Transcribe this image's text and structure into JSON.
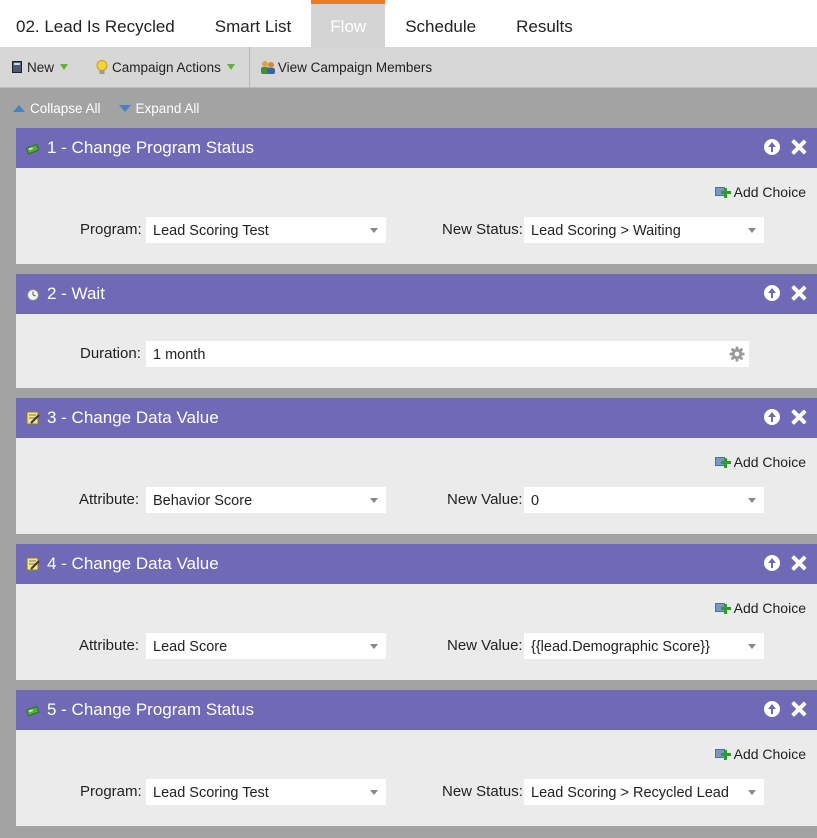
{
  "tabs": [
    {
      "label": "02. Lead Is Recycled",
      "active": false
    },
    {
      "label": "Smart List",
      "active": false
    },
    {
      "label": "Flow",
      "active": true
    },
    {
      "label": "Schedule",
      "active": false
    },
    {
      "label": "Results",
      "active": false
    }
  ],
  "toolbar": {
    "new_label": "New",
    "campaign_actions_label": "Campaign Actions",
    "view_members_label": "View Campaign Members"
  },
  "collapse_label": "Collapse All",
  "expand_label": "Expand All",
  "add_choice_label": "Add Choice",
  "steps": [
    {
      "title": "1 - Change Program Status",
      "icon": "program-status-icon",
      "f1_label": "Program:",
      "f1_value": "Lead Scoring Test",
      "f2_label": "New Status:",
      "f2_value": "Lead Scoring > Waiting"
    },
    {
      "title": "2 - Wait",
      "icon": "clock-icon",
      "f1_label": "Duration:",
      "f1_value": "1 month"
    },
    {
      "title": "3 - Change Data Value",
      "icon": "data-value-icon",
      "f1_label": "Attribute:",
      "f1_value": "Behavior Score",
      "f2_label": "New Value:",
      "f2_value": "0"
    },
    {
      "title": "4 - Change Data Value",
      "icon": "data-value-icon",
      "f1_label": "Attribute:",
      "f1_value": "Lead Score",
      "f2_label": "New Value:",
      "f2_value": "{{lead.Demographic Score}}"
    },
    {
      "title": "5 - Change Program Status",
      "icon": "program-status-icon",
      "f1_label": "Program:",
      "f1_value": "Lead Scoring Test",
      "f2_label": "New Status:",
      "f2_value": "Lead Scoring > Recycled Lead"
    }
  ],
  "colors": {
    "step_header": "#6f69b6",
    "active_tab_border": "#f07a24",
    "step_body": "#ebebeb",
    "page_background": "#a3a3a3"
  }
}
